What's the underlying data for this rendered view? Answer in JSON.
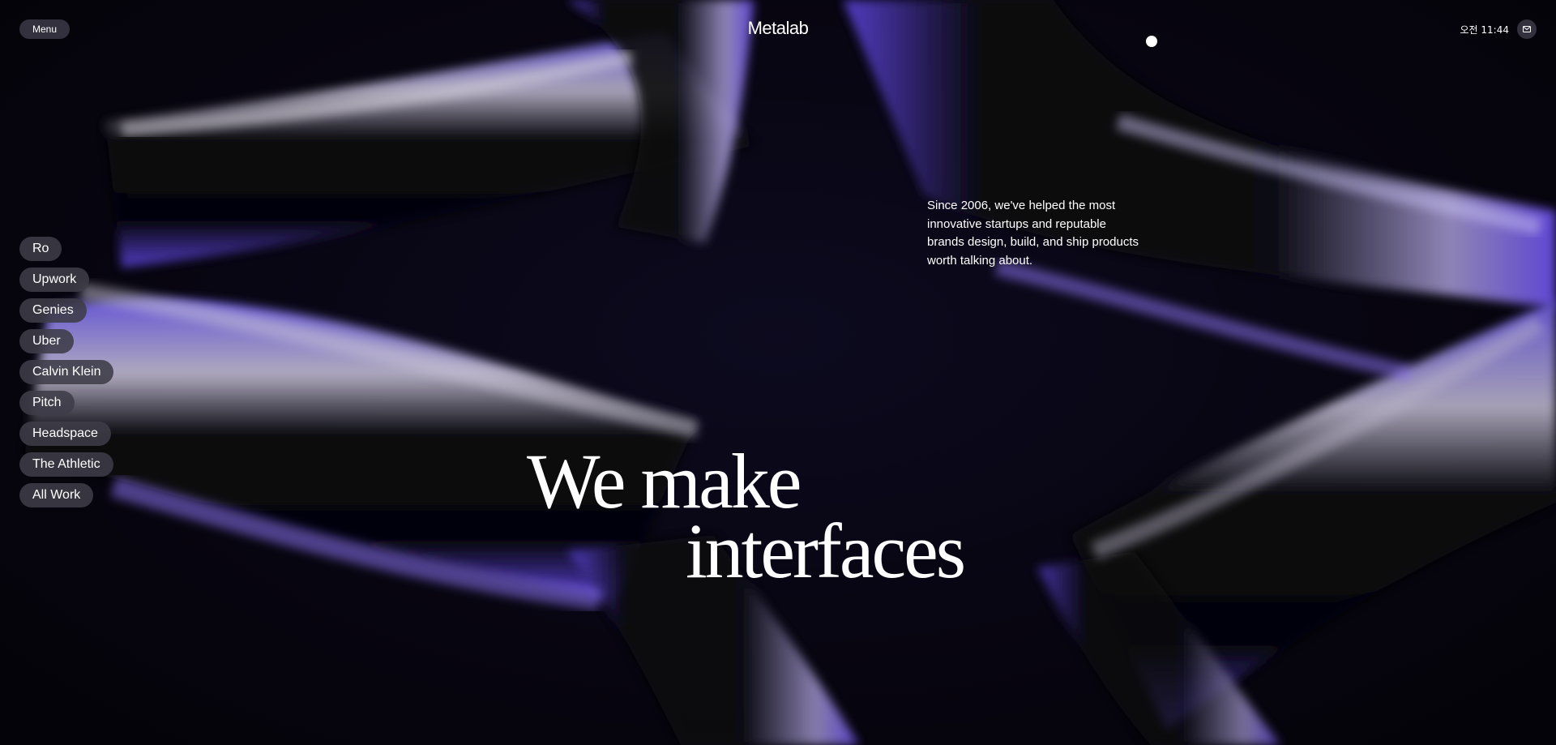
{
  "header": {
    "menu_label": "Menu",
    "brand": "Metalab",
    "clock": "오전 11:44",
    "mail_icon": "mail-icon"
  },
  "intro": {
    "text": "Since 2006, we've helped the most innovative startups and reputable brands design, build, and ship products worth talking about."
  },
  "work_list": {
    "items": [
      {
        "label": "Ro"
      },
      {
        "label": "Upwork"
      },
      {
        "label": "Genies"
      },
      {
        "label": "Uber"
      },
      {
        "label": "Calvin Klein"
      },
      {
        "label": "Pitch"
      },
      {
        "label": "Headspace"
      },
      {
        "label": "The Athletic"
      },
      {
        "label": "All Work"
      }
    ]
  },
  "hero": {
    "line1": "We make",
    "line2": "interfaces"
  },
  "colors": {
    "background": "#07050f",
    "accent_purple": "#6a4ee8",
    "pill_bg": "#3e3c48"
  }
}
